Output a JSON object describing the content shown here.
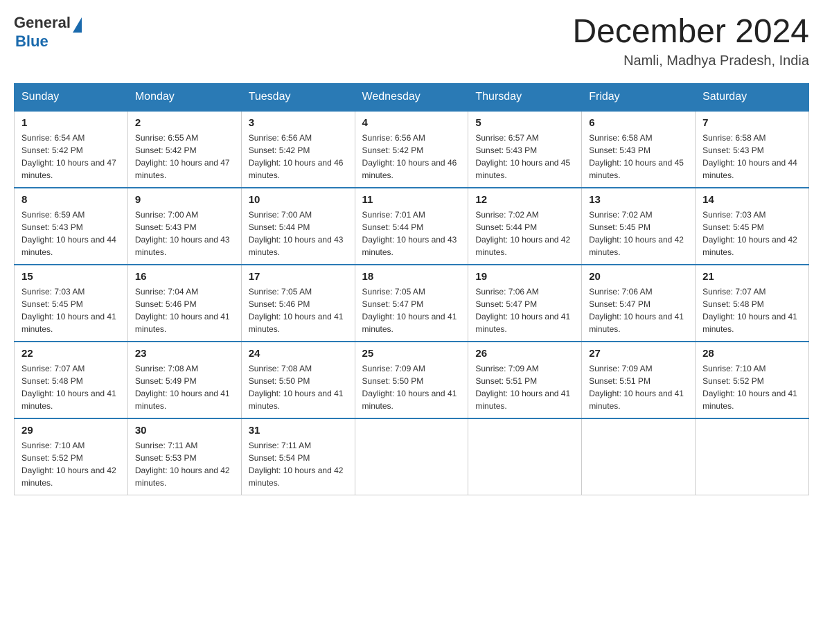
{
  "header": {
    "logo": {
      "general": "General",
      "blue": "Blue"
    },
    "title": "December 2024",
    "location": "Namli, Madhya Pradesh, India"
  },
  "weekdays": [
    "Sunday",
    "Monday",
    "Tuesday",
    "Wednesday",
    "Thursday",
    "Friday",
    "Saturday"
  ],
  "weeks": [
    [
      {
        "day": "1",
        "sunrise": "6:54 AM",
        "sunset": "5:42 PM",
        "daylight": "10 hours and 47 minutes."
      },
      {
        "day": "2",
        "sunrise": "6:55 AM",
        "sunset": "5:42 PM",
        "daylight": "10 hours and 47 minutes."
      },
      {
        "day": "3",
        "sunrise": "6:56 AM",
        "sunset": "5:42 PM",
        "daylight": "10 hours and 46 minutes."
      },
      {
        "day": "4",
        "sunrise": "6:56 AM",
        "sunset": "5:42 PM",
        "daylight": "10 hours and 46 minutes."
      },
      {
        "day": "5",
        "sunrise": "6:57 AM",
        "sunset": "5:43 PM",
        "daylight": "10 hours and 45 minutes."
      },
      {
        "day": "6",
        "sunrise": "6:58 AM",
        "sunset": "5:43 PM",
        "daylight": "10 hours and 45 minutes."
      },
      {
        "day": "7",
        "sunrise": "6:58 AM",
        "sunset": "5:43 PM",
        "daylight": "10 hours and 44 minutes."
      }
    ],
    [
      {
        "day": "8",
        "sunrise": "6:59 AM",
        "sunset": "5:43 PM",
        "daylight": "10 hours and 44 minutes."
      },
      {
        "day": "9",
        "sunrise": "7:00 AM",
        "sunset": "5:43 PM",
        "daylight": "10 hours and 43 minutes."
      },
      {
        "day": "10",
        "sunrise": "7:00 AM",
        "sunset": "5:44 PM",
        "daylight": "10 hours and 43 minutes."
      },
      {
        "day": "11",
        "sunrise": "7:01 AM",
        "sunset": "5:44 PM",
        "daylight": "10 hours and 43 minutes."
      },
      {
        "day": "12",
        "sunrise": "7:02 AM",
        "sunset": "5:44 PM",
        "daylight": "10 hours and 42 minutes."
      },
      {
        "day": "13",
        "sunrise": "7:02 AM",
        "sunset": "5:45 PM",
        "daylight": "10 hours and 42 minutes."
      },
      {
        "day": "14",
        "sunrise": "7:03 AM",
        "sunset": "5:45 PM",
        "daylight": "10 hours and 42 minutes."
      }
    ],
    [
      {
        "day": "15",
        "sunrise": "7:03 AM",
        "sunset": "5:45 PM",
        "daylight": "10 hours and 41 minutes."
      },
      {
        "day": "16",
        "sunrise": "7:04 AM",
        "sunset": "5:46 PM",
        "daylight": "10 hours and 41 minutes."
      },
      {
        "day": "17",
        "sunrise": "7:05 AM",
        "sunset": "5:46 PM",
        "daylight": "10 hours and 41 minutes."
      },
      {
        "day": "18",
        "sunrise": "7:05 AM",
        "sunset": "5:47 PM",
        "daylight": "10 hours and 41 minutes."
      },
      {
        "day": "19",
        "sunrise": "7:06 AM",
        "sunset": "5:47 PM",
        "daylight": "10 hours and 41 minutes."
      },
      {
        "day": "20",
        "sunrise": "7:06 AM",
        "sunset": "5:47 PM",
        "daylight": "10 hours and 41 minutes."
      },
      {
        "day": "21",
        "sunrise": "7:07 AM",
        "sunset": "5:48 PM",
        "daylight": "10 hours and 41 minutes."
      }
    ],
    [
      {
        "day": "22",
        "sunrise": "7:07 AM",
        "sunset": "5:48 PM",
        "daylight": "10 hours and 41 minutes."
      },
      {
        "day": "23",
        "sunrise": "7:08 AM",
        "sunset": "5:49 PM",
        "daylight": "10 hours and 41 minutes."
      },
      {
        "day": "24",
        "sunrise": "7:08 AM",
        "sunset": "5:50 PM",
        "daylight": "10 hours and 41 minutes."
      },
      {
        "day": "25",
        "sunrise": "7:09 AM",
        "sunset": "5:50 PM",
        "daylight": "10 hours and 41 minutes."
      },
      {
        "day": "26",
        "sunrise": "7:09 AM",
        "sunset": "5:51 PM",
        "daylight": "10 hours and 41 minutes."
      },
      {
        "day": "27",
        "sunrise": "7:09 AM",
        "sunset": "5:51 PM",
        "daylight": "10 hours and 41 minutes."
      },
      {
        "day": "28",
        "sunrise": "7:10 AM",
        "sunset": "5:52 PM",
        "daylight": "10 hours and 41 minutes."
      }
    ],
    [
      {
        "day": "29",
        "sunrise": "7:10 AM",
        "sunset": "5:52 PM",
        "daylight": "10 hours and 42 minutes."
      },
      {
        "day": "30",
        "sunrise": "7:11 AM",
        "sunset": "5:53 PM",
        "daylight": "10 hours and 42 minutes."
      },
      {
        "day": "31",
        "sunrise": "7:11 AM",
        "sunset": "5:54 PM",
        "daylight": "10 hours and 42 minutes."
      },
      null,
      null,
      null,
      null
    ]
  ]
}
